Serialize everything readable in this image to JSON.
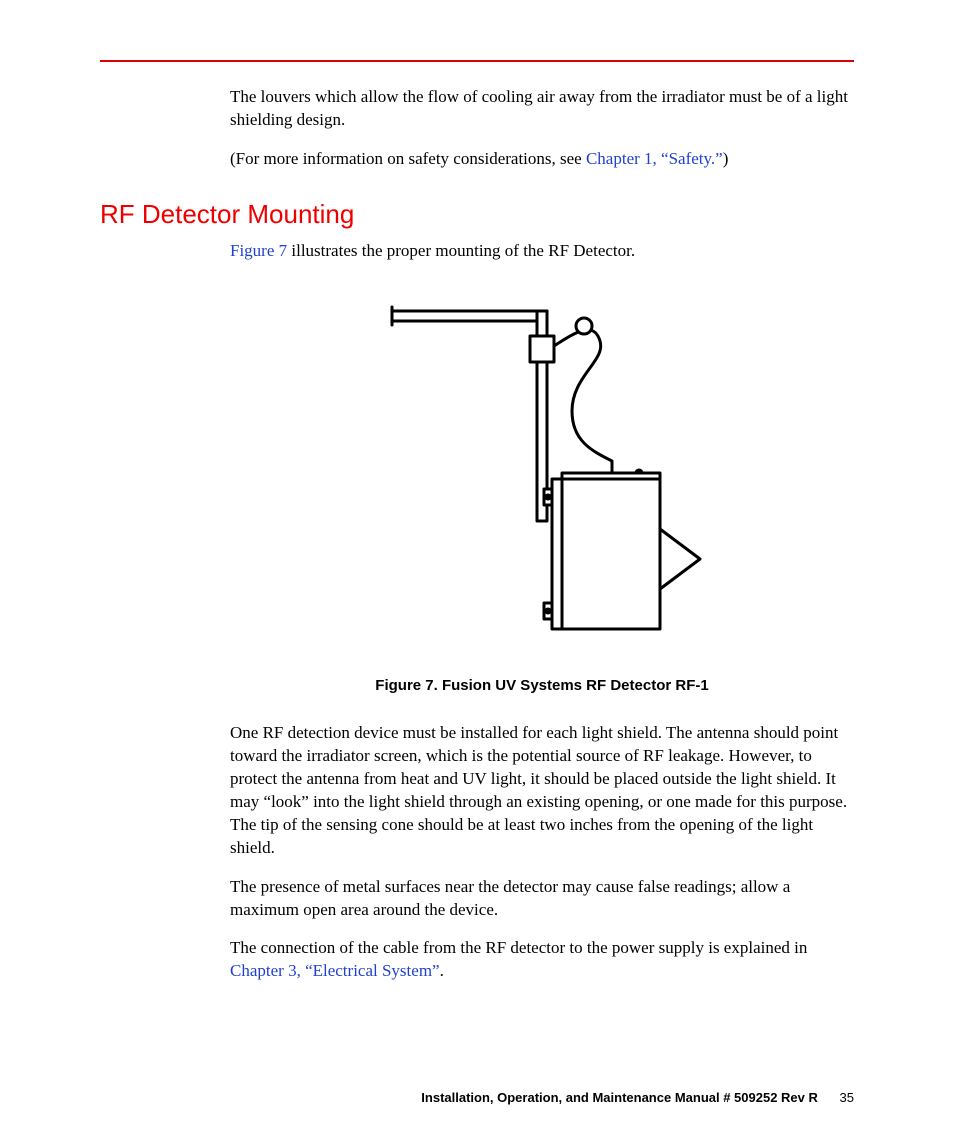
{
  "para_louvers": "The louvers which allow the flow of cooling air away from the irradiator must be of a light shielding design.",
  "para_safety_pre": "(For more information on safety considerations, see ",
  "xref_safety": "Chapter 1, “Safety.”",
  "para_safety_post": ")",
  "heading_rf": "RF Detector Mounting",
  "xref_figure7": "Figure 7",
  "para_fig_illustrates": " illustrates the proper mounting of the RF Detector.",
  "figure_caption": "Figure 7. Fusion UV Systems RF Detector RF-1",
  "para_one_rf": "One RF detection device must be installed for each light shield. The antenna should point toward the irradiator screen, which is the potential source of RF leakage. However, to protect the antenna from heat and UV light, it should be placed outside the light shield. It may “look” into the light shield through an existing opening, or one made for this purpose. The tip of the sensing cone should be at least two inches from the opening of the light shield.",
  "para_metal": "The presence of metal surfaces near the detector may cause false readings; allow a maximum open area around the device.",
  "para_cable_pre": "The connection of the cable from the RF detector to the power supply is explained in ",
  "xref_elec": "Chapter 3, “Electrical System”",
  "para_cable_post": ".",
  "footer_title": "Installation, Operation, and Maintenance Manual  # 509252 Rev R",
  "footer_page": "35"
}
